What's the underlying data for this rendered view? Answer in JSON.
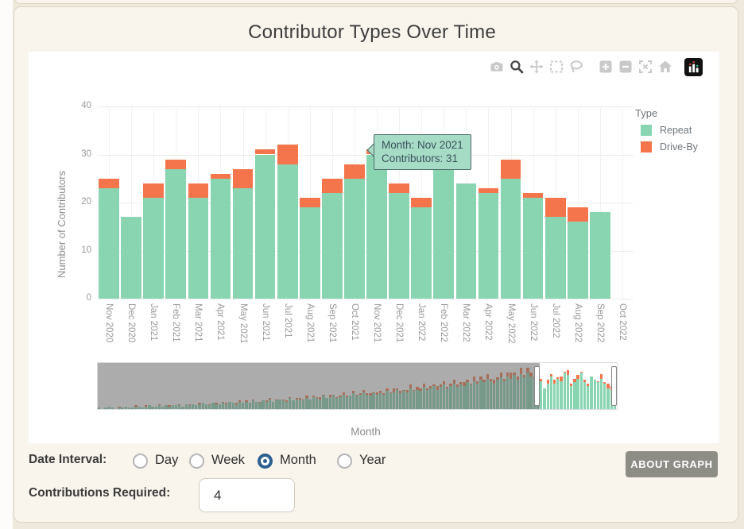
{
  "page": {
    "title": "Contributor Types Over Time"
  },
  "modebar": {
    "icons": [
      "camera-icon",
      "zoom-icon",
      "pan-icon",
      "box-select-icon",
      "lasso-icon",
      "zoom-in-icon",
      "zoom-out-icon",
      "autoscale-icon",
      "home-icon",
      "plotly-logo-icon"
    ],
    "active": "zoom-icon"
  },
  "chart_data": {
    "type": "bar",
    "stacked": true,
    "title": "Contributor Types Over Time",
    "xlabel": "Month",
    "ylabel": "Number of Contributors",
    "ylim": [
      0,
      40
    ],
    "ytick_labels": [
      "0",
      "10",
      "20",
      "30",
      "40"
    ],
    "grid": true,
    "legend_position": "right",
    "legend_title": "Type",
    "categories": [
      "Nov 2020",
      "Dec 2020",
      "Jan 2021",
      "Feb 2021",
      "Mar 2021",
      "Apr 2021",
      "May 2021",
      "Jun 2021",
      "Jul 2021",
      "Aug 2021",
      "Sep 2021",
      "Oct 2021",
      "Nov 2021",
      "Dec 2021",
      "Jan 2022",
      "Feb 2022",
      "Mar 2022",
      "Apr 2022",
      "May 2022",
      "Jun 2022",
      "Jul 2022",
      "Aug 2022",
      "Sep 2022",
      "Oct 2022"
    ],
    "series": [
      {
        "name": "Repeat",
        "color": "#89d5b2",
        "values": [
          23,
          17,
          21,
          27,
          21,
          25,
          23,
          30,
          28,
          19,
          22,
          25,
          30,
          22,
          19,
          27,
          24,
          22,
          25,
          21,
          17,
          16,
          18,
          0
        ]
      },
      {
        "name": "Drive-By",
        "color": "#f4754b",
        "values": [
          2,
          0,
          3,
          2,
          3,
          1,
          4,
          1,
          4,
          2,
          3,
          3,
          1,
          2,
          2,
          0,
          0,
          1,
          4,
          1,
          4,
          3,
          0,
          0
        ]
      }
    ]
  },
  "tooltip": {
    "line1": "Month: Nov 2021",
    "line2": "Contributors: 31"
  },
  "rangeslider": {
    "note": "full project history at month granularity; window = Nov 2020 - Oct 2022",
    "history": [
      [
        1,
        0
      ],
      [
        0,
        0
      ],
      [
        1,
        0
      ],
      [
        2,
        0
      ],
      [
        1,
        0
      ],
      [
        0,
        0
      ],
      [
        1,
        1
      ],
      [
        1,
        0
      ],
      [
        2,
        0
      ],
      [
        1,
        0
      ],
      [
        1,
        0
      ],
      [
        2,
        1
      ],
      [
        2,
        0
      ],
      [
        1,
        0
      ],
      [
        2,
        1
      ],
      [
        3,
        0
      ],
      [
        2,
        0
      ],
      [
        2,
        0
      ],
      [
        3,
        1
      ],
      [
        2,
        0
      ],
      [
        3,
        0
      ],
      [
        2,
        1
      ],
      [
        3,
        0
      ],
      [
        3,
        0
      ],
      [
        3,
        1
      ],
      [
        2,
        0
      ],
      [
        4,
        0
      ],
      [
        3,
        1
      ],
      [
        4,
        0
      ],
      [
        3,
        0
      ],
      [
        4,
        1
      ],
      [
        5,
        0
      ],
      [
        4,
        0
      ],
      [
        3,
        1
      ],
      [
        5,
        0
      ],
      [
        4,
        1
      ],
      [
        4,
        0
      ],
      [
        5,
        1
      ],
      [
        4,
        1
      ],
      [
        6,
        0
      ],
      [
        5,
        0
      ],
      [
        4,
        1
      ],
      [
        6,
        1
      ],
      [
        5,
        0
      ],
      [
        6,
        1
      ],
      [
        5,
        0
      ],
      [
        7,
        1
      ],
      [
        6,
        0
      ],
      [
        5,
        1
      ],
      [
        7,
        0
      ],
      [
        6,
        1
      ],
      [
        8,
        1
      ],
      [
        6,
        0
      ],
      [
        7,
        1
      ],
      [
        8,
        0
      ],
      [
        7,
        1
      ],
      [
        6,
        1
      ],
      [
        9,
        1
      ],
      [
        7,
        0
      ],
      [
        8,
        1
      ],
      [
        8,
        1
      ],
      [
        7,
        1
      ],
      [
        9,
        2
      ],
      [
        8,
        0
      ],
      [
        10,
        1
      ],
      [
        9,
        1
      ],
      [
        8,
        2
      ],
      [
        11,
        1
      ],
      [
        9,
        0
      ],
      [
        10,
        2
      ],
      [
        11,
        1
      ],
      [
        9,
        1
      ],
      [
        10,
        1
      ],
      [
        12,
        2
      ],
      [
        10,
        1
      ],
      [
        11,
        0
      ],
      [
        13,
        2
      ],
      [
        11,
        1
      ],
      [
        12,
        1
      ],
      [
        14,
        2
      ],
      [
        12,
        1
      ],
      [
        11,
        2
      ],
      [
        13,
        1
      ],
      [
        12,
        2
      ],
      [
        13,
        2
      ],
      [
        12,
        1
      ],
      [
        15,
        2
      ],
      [
        13,
        1
      ],
      [
        14,
        3
      ],
      [
        16,
        1
      ],
      [
        13,
        2
      ],
      [
        15,
        1
      ],
      [
        14,
        2
      ],
      [
        17,
        3
      ],
      [
        15,
        1
      ],
      [
        16,
        2
      ],
      [
        15,
        2
      ],
      [
        18,
        3
      ],
      [
        16,
        1
      ],
      [
        17,
        2
      ],
      [
        19,
        1
      ],
      [
        16,
        3
      ],
      [
        18,
        2
      ],
      [
        20,
        3
      ],
      [
        17,
        1
      ],
      [
        19,
        2
      ],
      [
        21,
        3
      ],
      [
        18,
        2
      ],
      [
        20,
        2
      ],
      [
        19,
        3
      ],
      [
        22,
        2
      ],
      [
        20,
        1
      ],
      [
        23,
        4
      ],
      [
        21,
        2
      ],
      [
        24,
        3
      ],
      [
        22,
        2
      ],
      [
        25,
        4
      ],
      [
        23,
        2
      ],
      [
        21,
        3
      ],
      [
        24,
        2
      ],
      [
        26,
        4
      ],
      [
        23,
        2
      ],
      [
        27,
        3
      ],
      [
        25,
        5
      ],
      [
        28,
        2
      ],
      [
        24,
        3
      ],
      [
        29,
        5
      ],
      [
        26,
        2
      ],
      [
        30,
        4
      ],
      [
        27,
        3
      ],
      [
        25,
        2
      ],
      [
        28,
        4
      ]
    ]
  },
  "controls": {
    "date_interval": {
      "label": "Date Interval:",
      "options": [
        {
          "label": "Day"
        },
        {
          "label": "Week"
        },
        {
          "label": "Month"
        },
        {
          "label": "Year"
        }
      ],
      "selected": "Month"
    },
    "contributions": {
      "label": "Contributions Required:",
      "value": "4"
    },
    "about_button": "ABOUT GRAPH"
  }
}
